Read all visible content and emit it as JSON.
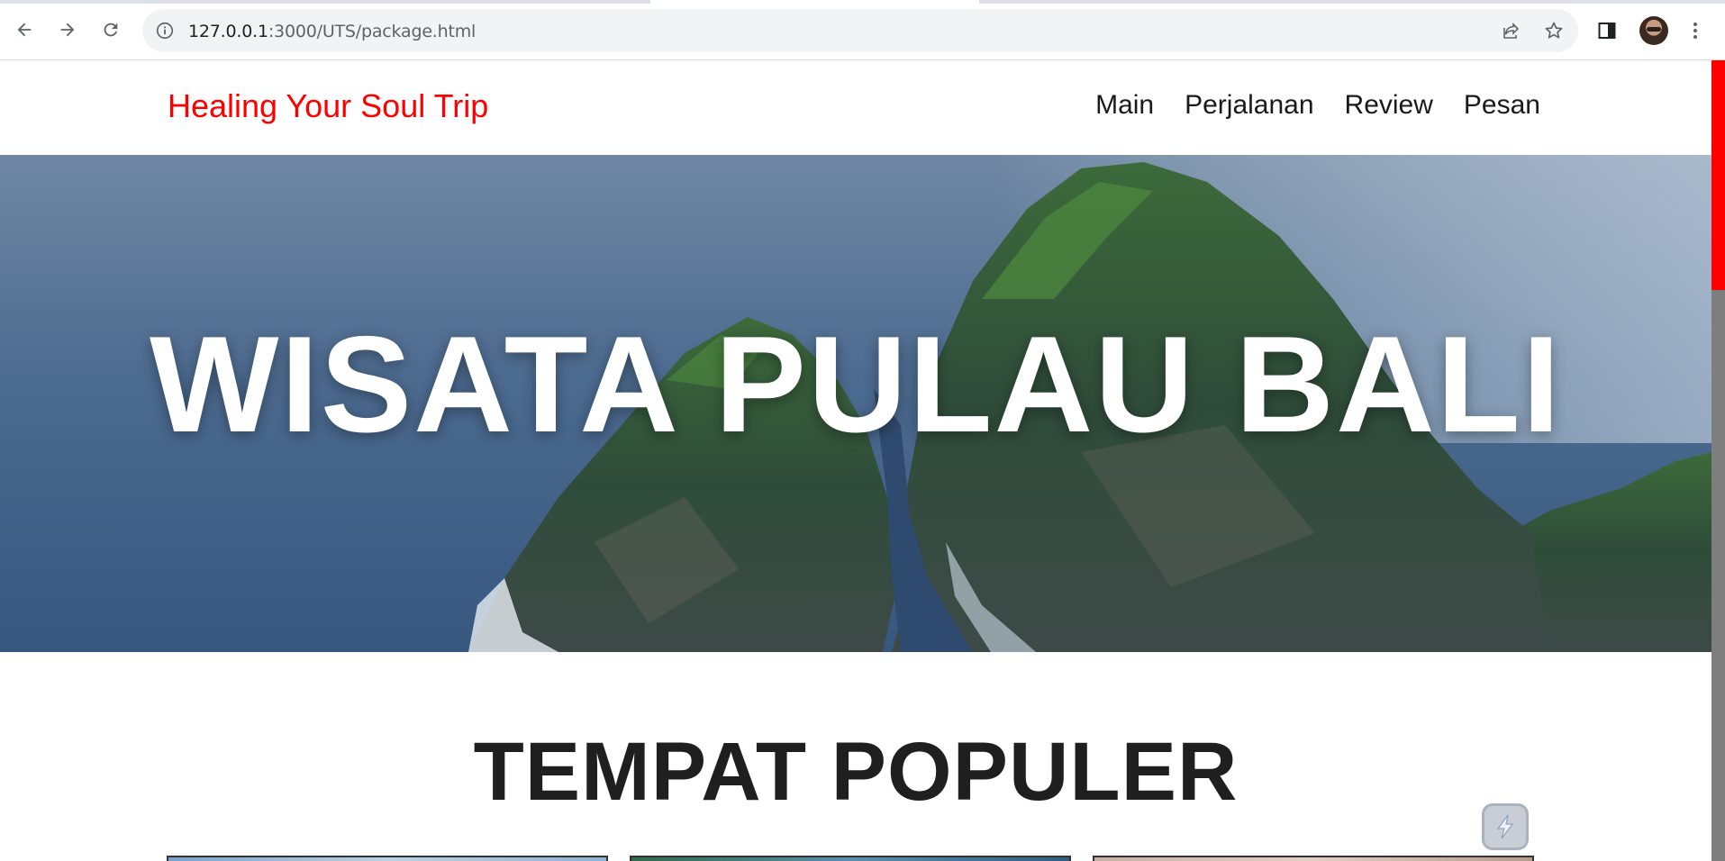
{
  "browser": {
    "url_host": "127.0.0.1",
    "url_rest": ":3000/UTS/package.html",
    "icons": [
      "back-icon",
      "forward-icon",
      "reload-icon",
      "info-icon",
      "share-icon",
      "star-icon",
      "side-panel-icon",
      "avatar",
      "menu-icon"
    ]
  },
  "site": {
    "brand": "Healing Your Soul Trip",
    "nav": [
      {
        "label": "Main"
      },
      {
        "label": "Perjalanan"
      },
      {
        "label": "Review"
      },
      {
        "label": "Pesan"
      }
    ]
  },
  "hero": {
    "title": "WISATA PULAU BALI"
  },
  "section": {
    "title": "TEMPAT POPULER"
  },
  "colors": {
    "brand": "#ff0000",
    "scroll_thumb": "#ff0000",
    "sea": "#4a6a8c"
  }
}
